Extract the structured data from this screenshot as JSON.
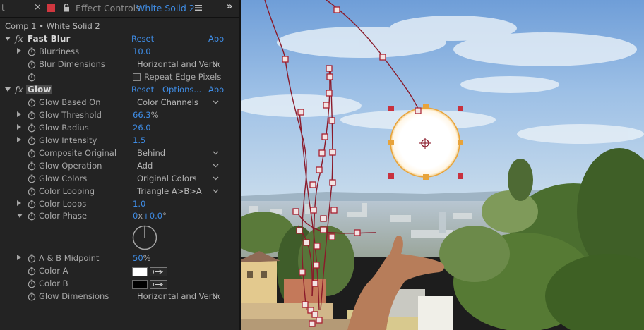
{
  "panel_tab": {
    "edge_glyph": "t",
    "close": "×",
    "title": "Effect Controls",
    "layer_name": "White Solid 2",
    "more": "»"
  },
  "breadcrumb": "Comp 1 • White Solid 2",
  "effects": {
    "fast_blur": {
      "name": "Fast Blur",
      "reset": "Reset",
      "about": "Abo",
      "blurriness": {
        "label": "Blurriness",
        "value": "10.0"
      },
      "blur_dimensions": {
        "label": "Blur Dimensions",
        "value": "Horizontal and Vertical"
      },
      "repeat_edge_pixels": {
        "label": "Repeat Edge Pixels",
        "checked": false
      }
    },
    "glow": {
      "name": "Glow",
      "reset": "Reset",
      "options": "Options...",
      "about": "Abo",
      "glow_based_on": {
        "label": "Glow Based On",
        "value": "Color Channels"
      },
      "glow_threshold": {
        "label": "Glow Threshold",
        "value": "66.3",
        "unit": "%"
      },
      "glow_radius": {
        "label": "Glow Radius",
        "value": "26.0"
      },
      "glow_intensity": {
        "label": "Glow Intensity",
        "value": "1.5"
      },
      "composite_original": {
        "label": "Composite Original",
        "value": "Behind"
      },
      "glow_operation": {
        "label": "Glow Operation",
        "value": "Add"
      },
      "glow_colors": {
        "label": "Glow Colors",
        "value": "Original Colors"
      },
      "color_looping": {
        "label": "Color Looping",
        "value": "Triangle A>B>A"
      },
      "color_loops": {
        "label": "Color Loops",
        "value": "1.0"
      },
      "color_phase": {
        "label": "Color Phase",
        "revolutions": "0",
        "rev_unit": "x",
        "degrees": "+0.0",
        "deg_unit": "°"
      },
      "ab_midpoint": {
        "label": "A & B Midpoint",
        "value": "50",
        "unit": "%"
      },
      "color_a": {
        "label": "Color A",
        "color": "#ffffff"
      },
      "color_b": {
        "label": "Color B",
        "color": "#000000"
      },
      "glow_dimensions": {
        "label": "Glow Dimensions",
        "value": "Horizontal and Vertical"
      }
    }
  },
  "colors": {
    "accent_blue": "#3f8de6",
    "label_color_swatch": "#d0373f",
    "panel_bg": "#232323",
    "motion_path": "#8a1a2a",
    "keyframe": "#c4404a",
    "layer_handle_orange": "#e8a33a"
  },
  "icons": [
    "close-icon",
    "label-color-swatch",
    "lock-icon",
    "panel-menu-icon",
    "panel-overflow-icon",
    "fx-icon",
    "stopwatch-icon",
    "twirl-triangle-icon",
    "chevron-down-icon",
    "eyedropper-icon",
    "angle-dial"
  ]
}
